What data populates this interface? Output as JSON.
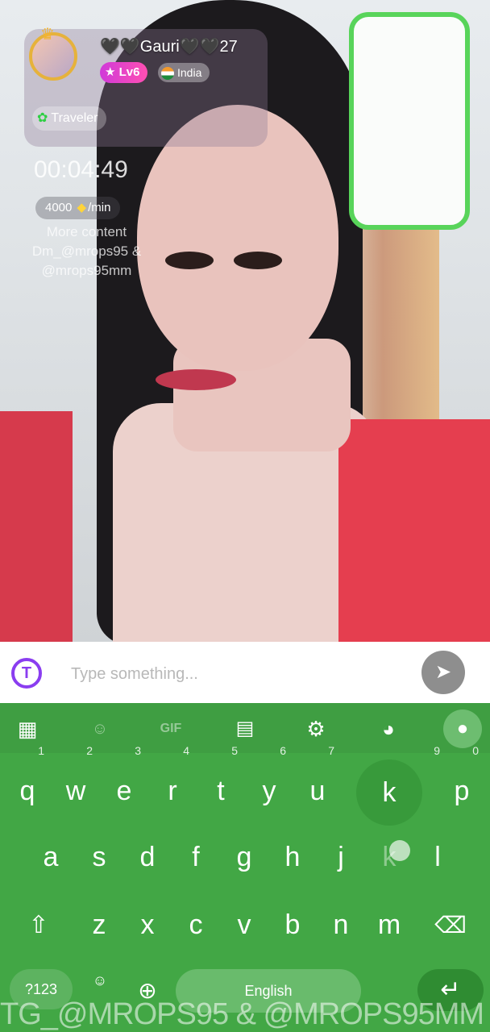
{
  "profile": {
    "name": "🖤🖤Gauri🖤🖤27",
    "level": "Lv6",
    "country": "India",
    "tag": "Traveler"
  },
  "call": {
    "timer": "00:04:49",
    "rate_value": "4000",
    "rate_unit": "/min"
  },
  "watermark_overlay": "More content Dm_@mrops95 & @mrops95mm",
  "message": {
    "placeholder": "Type something..."
  },
  "keyboard": {
    "toolbar": [
      "apps",
      "sticker",
      "GIF",
      "clipboard",
      "settings",
      "theme",
      "mic"
    ],
    "row1": [
      {
        "k": "q",
        "n": "1"
      },
      {
        "k": "w",
        "n": "2"
      },
      {
        "k": "e",
        "n": "3"
      },
      {
        "k": "r",
        "n": "4"
      },
      {
        "k": "t",
        "n": "5"
      },
      {
        "k": "y",
        "n": "6"
      },
      {
        "k": "u",
        "n": "7"
      },
      {
        "k": "k",
        "n": ""
      },
      {
        "k": "",
        "n": "9"
      },
      {
        "k": "p",
        "n": "0"
      }
    ],
    "row2": [
      "a",
      "s",
      "d",
      "f",
      "g",
      "h",
      "j",
      "k",
      "l"
    ],
    "row3": [
      "z",
      "x",
      "c",
      "v",
      "b",
      "n",
      "m"
    ],
    "num_label": "?123",
    "space_label": "English"
  },
  "watermark_bottom": "TG_@MROPS95 & @MROPS95MM",
  "colors": {
    "keyboard_bg": "#42a745",
    "accent_purple": "#8a3df0",
    "level_badge": "#d03ad9"
  }
}
